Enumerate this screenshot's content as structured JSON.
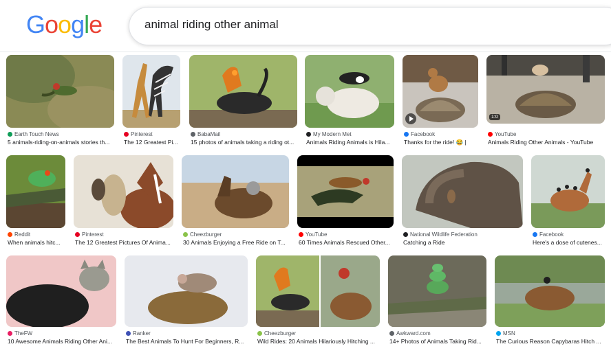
{
  "header": {
    "logo": "Google",
    "logo_colors": [
      "#4285F4",
      "#EA4335",
      "#FBBC05",
      "#4285F4",
      "#34A853",
      "#EA4335"
    ],
    "search_query": "animal riding other animal"
  },
  "results": [
    {
      "source": "Earth Touch News",
      "title": "5 animals-riding-on-animals stories th...",
      "fav_color": "#0f9d58"
    },
    {
      "source": "Pinterest",
      "title": "The 12 Greatest Pi...",
      "fav_color": "#e60023"
    },
    {
      "source": "BabaMail",
      "title": "15 photos of animals taking a riding ot...",
      "fav_color": "#5f6368"
    },
    {
      "source": "My Modern Met",
      "title": "Animals Riding Animals is Hila...",
      "fav_color": "#202124"
    },
    {
      "source": "Facebook",
      "title": "Thanks for the ride! 😂 |",
      "fav_color": "#1877f2"
    },
    {
      "source": "YouTube",
      "title": "Animals Riding Other Animals - YouTube",
      "fav_color": "#ff0000"
    },
    {
      "source": "Reddit",
      "title": "When animals hitc...",
      "fav_color": "#ff4500"
    },
    {
      "source": "Pinterest",
      "title": "The 12 Greatest Pictures Of Anima...",
      "fav_color": "#e60023"
    },
    {
      "source": "Cheezburger",
      "title": "30 Animals Enjoying a Free Ride on T...",
      "fav_color": "#8bc34a"
    },
    {
      "source": "YouTube",
      "title": "60 Times Animals Rescued Other...",
      "fav_color": "#ff0000"
    },
    {
      "source": "National Wildlife Federation",
      "title": "Catching a Ride",
      "fav_color": "#202124"
    },
    {
      "source": "Facebook",
      "title": "Here's a dose of cutenes...",
      "fav_color": "#1877f2"
    },
    {
      "source": "TheFW",
      "title": "10 Awesome Animals Riding Other Ani...",
      "fav_color": "#e91e63"
    },
    {
      "source": "Ranker",
      "title": "The Best Animals To Hunt For Beginners, R...",
      "fav_color": "#3f51b5"
    },
    {
      "source": "Cheezburger",
      "title": "Wild Rides: 20 Animals Hilariously Hitching ...",
      "fav_color": "#8bc34a"
    },
    {
      "source": "Awkward.com",
      "title": "14+ Photos of Animals Taking Rid...",
      "fav_color": "#5f6368"
    },
    {
      "source": "MSN",
      "title": "The Curious Reason Capybaras Hitch ...",
      "fav_color": "#00a4ef"
    }
  ],
  "badges": {
    "youtube_duration": "1:0"
  }
}
